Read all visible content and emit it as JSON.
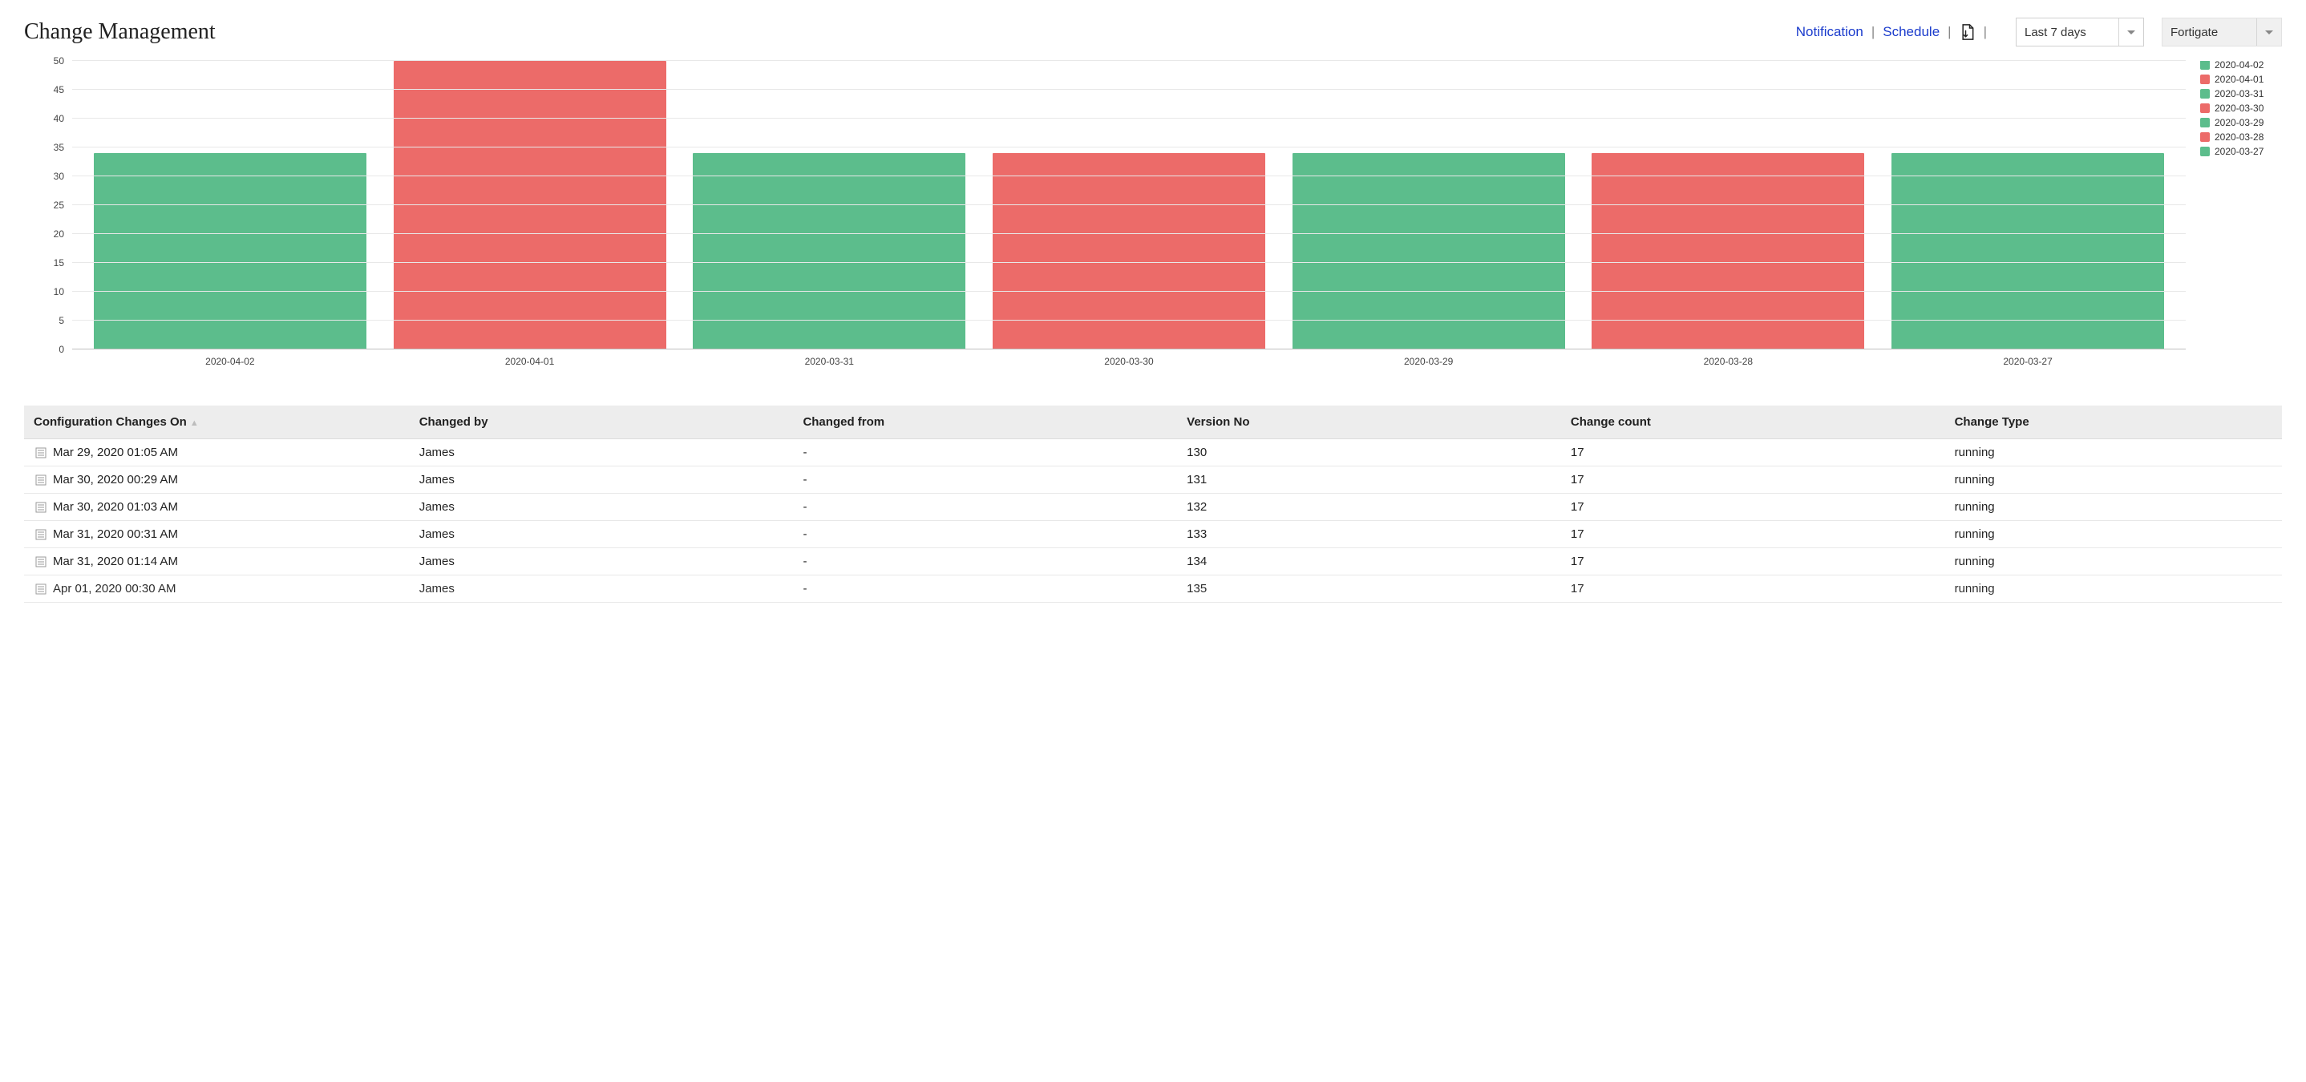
{
  "header": {
    "title": "Change Management",
    "links": {
      "notification": "Notification",
      "schedule": "Schedule"
    },
    "range_dropdown": "Last 7 days",
    "device_dropdown": "Fortigate"
  },
  "chart_data": {
    "type": "bar",
    "title": "",
    "xlabel": "",
    "ylabel": "",
    "ylim": [
      0,
      50
    ],
    "yticks": [
      0,
      5,
      10,
      15,
      20,
      25,
      30,
      35,
      40,
      45,
      50
    ],
    "categories": [
      "2020-04-02",
      "2020-04-01",
      "2020-03-31",
      "2020-03-30",
      "2020-03-29",
      "2020-03-28",
      "2020-03-27"
    ],
    "values": [
      34,
      51,
      34,
      34,
      34,
      34,
      34
    ],
    "colors": [
      "green",
      "red",
      "green",
      "red",
      "green",
      "red",
      "green"
    ],
    "legend": [
      {
        "label": "2020-04-02",
        "color": "green",
        "cut": true
      },
      {
        "label": "2020-04-01",
        "color": "red"
      },
      {
        "label": "2020-03-31",
        "color": "green"
      },
      {
        "label": "2020-03-30",
        "color": "red"
      },
      {
        "label": "2020-03-29",
        "color": "green"
      },
      {
        "label": "2020-03-28",
        "color": "red"
      },
      {
        "label": "2020-03-27",
        "color": "green"
      }
    ]
  },
  "table": {
    "columns": [
      "Configuration Changes On",
      "Changed by",
      "Changed from",
      "Version No",
      "Change count",
      "Change Type"
    ],
    "rows": [
      {
        "date": "Mar 29, 2020 01:05 AM",
        "by": "James",
        "from": "-",
        "version": "130",
        "count": "17",
        "type": "running"
      },
      {
        "date": "Mar 30, 2020 00:29 AM",
        "by": "James",
        "from": "-",
        "version": "131",
        "count": "17",
        "type": "running"
      },
      {
        "date": "Mar 30, 2020 01:03 AM",
        "by": "James",
        "from": "-",
        "version": "132",
        "count": "17",
        "type": "running"
      },
      {
        "date": "Mar 31, 2020 00:31 AM",
        "by": "James",
        "from": "-",
        "version": "133",
        "count": "17",
        "type": "running"
      },
      {
        "date": "Mar 31, 2020 01:14 AM",
        "by": "James",
        "from": "-",
        "version": "134",
        "count": "17",
        "type": "running"
      },
      {
        "date": "Apr 01, 2020 00:30 AM",
        "by": "James",
        "from": "-",
        "version": "135",
        "count": "17",
        "type": "running"
      }
    ]
  }
}
